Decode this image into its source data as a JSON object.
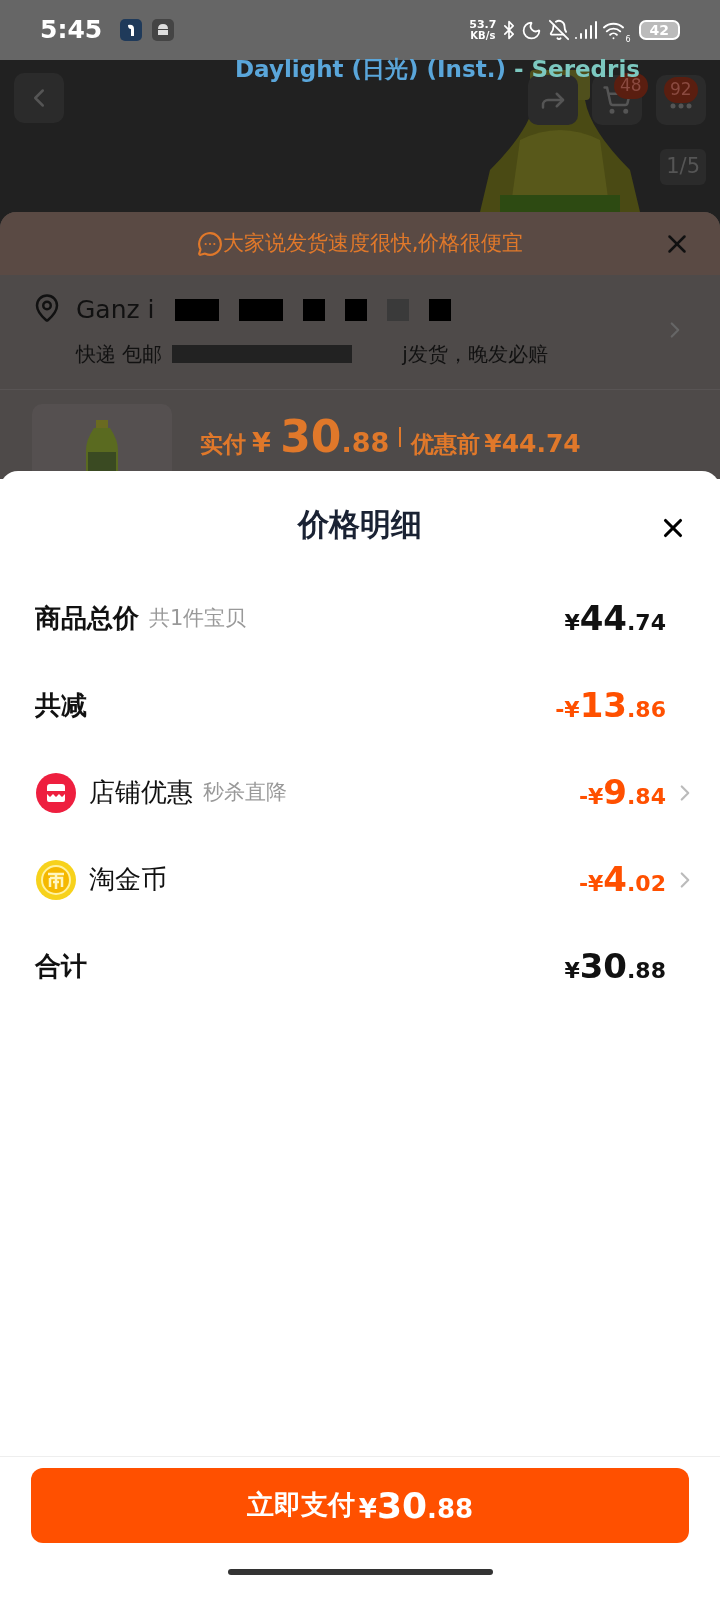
{
  "status_bar": {
    "time": "5:45",
    "net_speed": "53.7",
    "net_unit": "KB/s",
    "wifi_sub": "6",
    "battery": "42"
  },
  "lyrics_overlay": {
    "title": "Daylight (日光) (Inst.)",
    "separator": " - ",
    "artist": "Seredris"
  },
  "product_nav": {
    "cart_badge": "48",
    "more_badge": "92",
    "image_counter": "1/5"
  },
  "order_sheet": {
    "banner": "大家说发货速度很快,价格很便宜",
    "address_name": "Ganz i",
    "shipping_start": "快递 包邮",
    "shipping_end": "j发货，晚发必赔",
    "paid_label": "实付",
    "paid_amount": "¥ 30.88",
    "before_label": "优惠前",
    "before_amount": "¥44.74"
  },
  "price_detail": {
    "title": "价格明细",
    "rows": [
      {
        "kind": "total",
        "label": "商品总价",
        "note": "共1件宝贝",
        "amount": "¥44.74"
      },
      {
        "kind": "reduction",
        "label": "共减",
        "amount": "-¥13.86"
      },
      {
        "kind": "store",
        "label": "店铺优惠",
        "note": "秒杀直降",
        "amount": "-¥9.84"
      },
      {
        "kind": "coin",
        "label": "淘金币",
        "amount": "-¥4.02"
      },
      {
        "kind": "sum",
        "label": "合计",
        "amount": "¥30.88"
      }
    ],
    "pay_button": {
      "label": "立即支付",
      "amount": "¥30.88"
    }
  }
}
